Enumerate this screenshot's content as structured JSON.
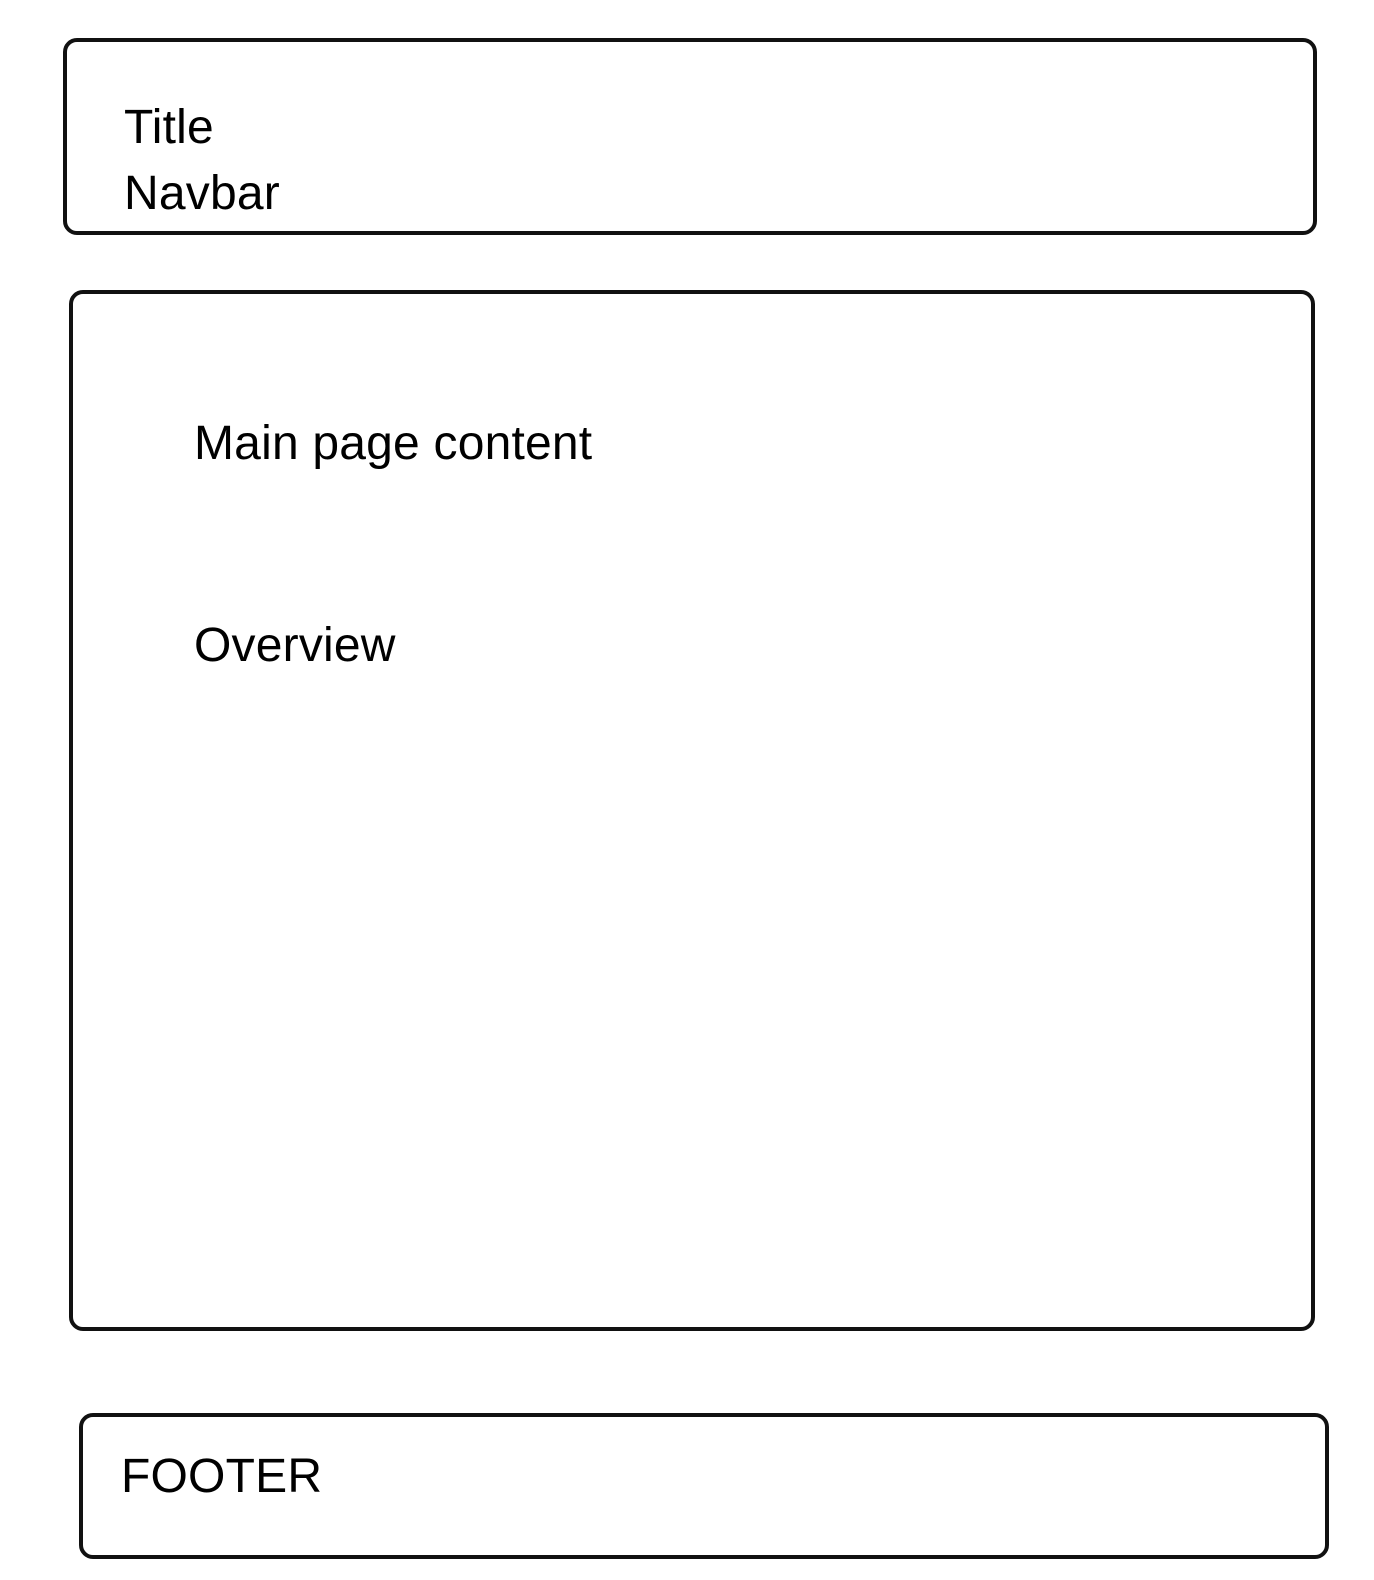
{
  "header": {
    "title": "Title",
    "navbar": "Navbar"
  },
  "main": {
    "content_label": "Main page content",
    "overview_label": "Overview"
  },
  "footer": {
    "label": "FOOTER"
  },
  "colors": {
    "border": "#111111",
    "background": "#ffffff",
    "text": "#000000"
  }
}
